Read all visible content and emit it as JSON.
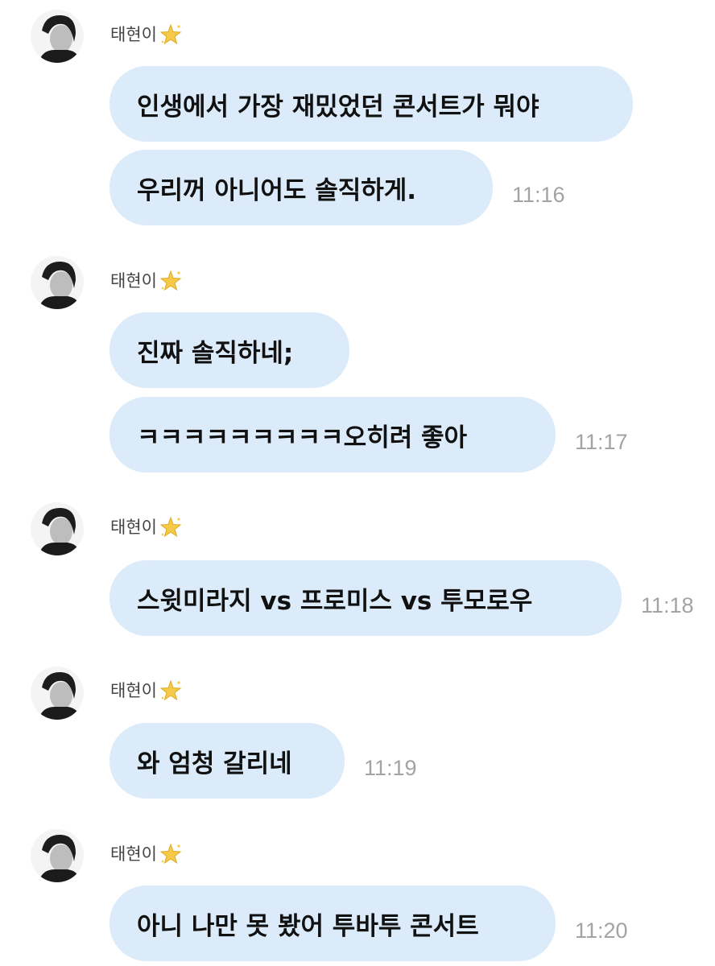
{
  "chat": {
    "groups": [
      {
        "sender": "태현이",
        "sender_badge": "sparkle-star",
        "messages": [
          {
            "text": "인생에서 가장 재밌었던 콘서트가 뭐야",
            "time": ""
          },
          {
            "text": "우리꺼 아니어도 솔직하게.",
            "time": "11:16"
          }
        ]
      },
      {
        "sender": "태현이",
        "sender_badge": "sparkle-star",
        "messages": [
          {
            "text": "진짜 솔직하네;",
            "time": ""
          },
          {
            "text": "ㅋㅋㅋㅋㅋㅋㅋㅋㅋ오히려 좋아",
            "time": "11:17"
          }
        ]
      },
      {
        "sender": "태현이",
        "sender_badge": "sparkle-star",
        "messages": [
          {
            "text": "스윗미라지 vs 프로미스 vs 투모로우",
            "time": "11:18"
          }
        ]
      },
      {
        "sender": "태현이",
        "sender_badge": "sparkle-star",
        "messages": [
          {
            "text": "와 엄청 갈리네",
            "time": "11:19"
          }
        ]
      },
      {
        "sender": "태현이",
        "sender_badge": "sparkle-star",
        "messages": [
          {
            "text": "아니 나만 못 봤어 투바투 콘서트",
            "time": "11:20"
          }
        ]
      }
    ]
  },
  "colors": {
    "bubble": "#dcebfa",
    "time": "#a3a3a3",
    "sender": "#444444",
    "text": "#111111"
  }
}
